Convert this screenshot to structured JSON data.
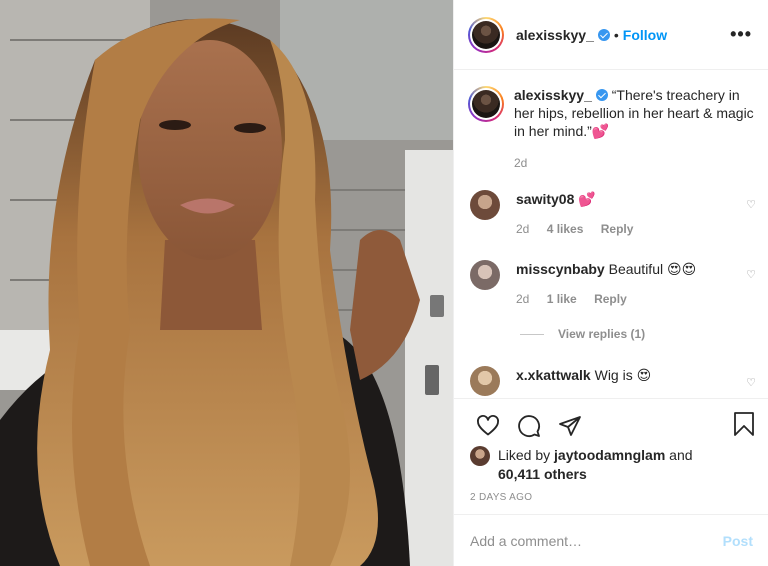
{
  "post": {
    "username": "alexisskyy_",
    "follow_label": "Follow",
    "separator": "•",
    "more_label": "•••"
  },
  "caption": {
    "username": "alexisskyy_",
    "text": " “There's treachery in her hips, rebellion in her heart & magic in her mind.”💕",
    "time": "2d"
  },
  "comments": [
    {
      "username": "sawity08",
      "text": " 💕",
      "time": "2d",
      "likes": "4 likes",
      "reply_label": "Reply"
    },
    {
      "username": "misscynbaby",
      "text": " Beautiful 😍😍",
      "time": "2d",
      "likes": "1 like",
      "reply_label": "Reply",
      "view_replies": "View replies (1)"
    },
    {
      "username": "x.xkattwalk",
      "text": " Wig is 😍"
    }
  ],
  "likes": {
    "prefix": "Liked by ",
    "user": "jaytoodamnglam",
    "middle": " and",
    "count": "60,411 others"
  },
  "posted_ago": "2 DAYS AGO",
  "comment_box": {
    "placeholder": "Add a comment…",
    "post_label": "Post"
  },
  "icons": [
    "heart-icon",
    "comment-icon",
    "share-icon",
    "bookmark-icon",
    "verified-icon"
  ],
  "colors": {
    "accent": "#0095f6",
    "verified": "#3897f0",
    "post_disabled": "#b2dffc"
  }
}
